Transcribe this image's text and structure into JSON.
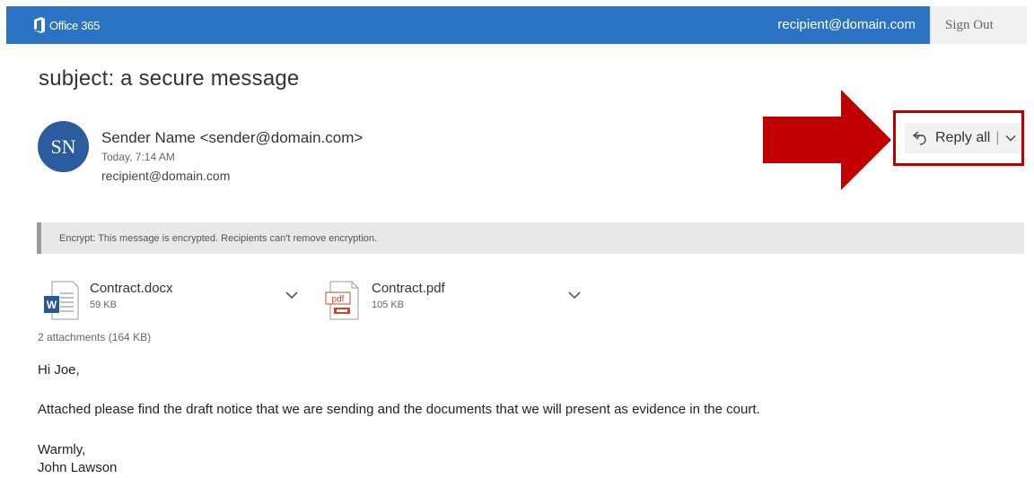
{
  "header": {
    "brand": "Office 365",
    "user_email": "recipient@domain.com",
    "sign_out": "Sign Out",
    "colors": {
      "bar": "#2d73c4",
      "signout_bg": "#f0f0f0"
    }
  },
  "message": {
    "subject": "subject: a secure message",
    "avatar_initials": "SN",
    "sender": "Sender Name <sender@domain.com>",
    "sent_time": "Today, 7:14 AM",
    "recipient": "recipient@domain.com",
    "reply_label": "Reply all",
    "reply_separator": "|",
    "encryption_notice": "Encrypt: This message is encrypted. Recipients can't remove encryption.",
    "attachments": [
      {
        "name": "Contract.docx",
        "size": "59 KB",
        "icon": "word-icon"
      },
      {
        "name": "Contract.pdf",
        "size": "105 KB",
        "icon": "pdf-icon"
      }
    ],
    "attachments_summary": "2 attachments (164 KB)",
    "body": {
      "greeting": "Hi Joe,",
      "paragraph": "Attached please find the draft notice that we are sending and the documents that we will present as evidence in the court.",
      "closing": "Warmly,",
      "signature": "John Lawson"
    }
  },
  "annotation": {
    "highlight_color": "#c00000",
    "arrow_color": "#c00000"
  }
}
